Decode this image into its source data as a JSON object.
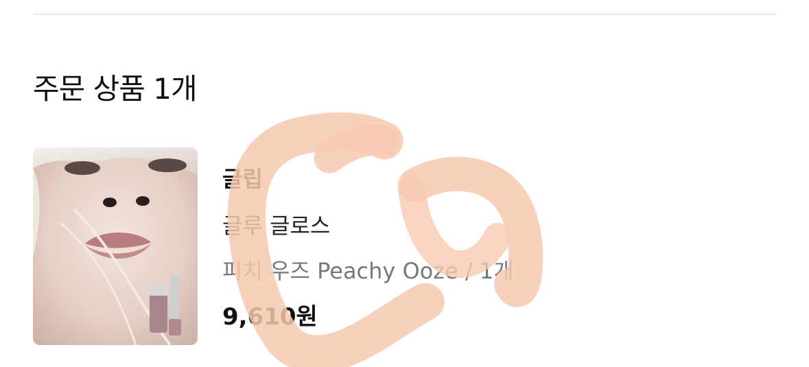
{
  "section": {
    "title": "주문 상품 1개"
  },
  "order_item": {
    "brand": "글립",
    "product_name": "글루 글로스",
    "option": "피치 우즈 Peachy Ooze / 1개",
    "price": "9,610원"
  },
  "colors": {
    "scribble": "#f7c9b2",
    "divider": "#eeeeee",
    "option_text": "#777777"
  }
}
